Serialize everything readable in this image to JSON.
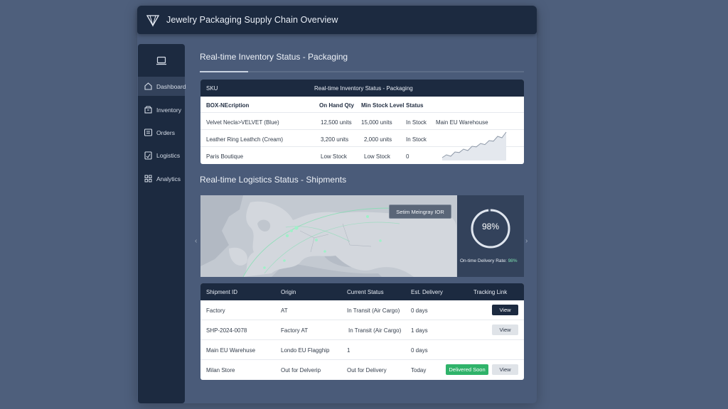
{
  "header": {
    "title": "Jewelry Packaging Supply Chain Overview"
  },
  "sidebar": {
    "items": [
      {
        "label": "Dashboard",
        "icon": "home-icon"
      },
      {
        "label": "Inventory",
        "icon": "box-icon"
      },
      {
        "label": "Orders",
        "icon": "list-icon"
      },
      {
        "label": "Logistics",
        "icon": "clipboard-icon"
      },
      {
        "label": "Analytics",
        "icon": "grid-icon"
      }
    ]
  },
  "inventory": {
    "section_title": "Real-time Inventory Status - Packaging",
    "head_col1": "SKU",
    "head_col2": "Real-time Inventory Status - Packaging",
    "columns": [
      "BOX-NEcription",
      "On Hand Qty",
      "Min Stock Level",
      "Status"
    ],
    "rows": [
      [
        "Velvet Necla>VELVET (Blue)",
        "12,500 units",
        "15,000 units",
        "In Stock",
        "Main EU Warehouse"
      ],
      [
        "Leather Ring Leathch (Cream)",
        "3,200 units",
        "2,000 units",
        "In Stock",
        ""
      ],
      [
        "Paris Boutique",
        "Low Stock",
        "Low Stock",
        "0",
        ""
      ]
    ],
    "sparkline": [
      3,
      4,
      3.5,
      5,
      4.8,
      6,
      5.5,
      7,
      6.8,
      8,
      7.6,
      9,
      8.8,
      10.5,
      10,
      12
    ]
  },
  "logistics": {
    "section_title": "Real-time Logistics Status - Shipments",
    "badge": "Setim Meingray IOR",
    "ontime_value": "98%",
    "ontime_fraction": 0.98,
    "ontime_label": "On-time Delivery Rate:",
    "ontime_rate": "98%",
    "colors": {
      "accent": "#2fb36a",
      "dark": "#1c2a40"
    }
  },
  "shipments": {
    "columns": [
      "Shipment ID",
      "Origin",
      "Current Status",
      "Est. Delivery",
      "Tracking Link"
    ],
    "rows": [
      {
        "id": "Factory",
        "origin": "AT",
        "status": "In Transit (Air Cargo)",
        "eta": "0 days",
        "button": "View",
        "button_style": "dark",
        "badge": ""
      },
      {
        "id": "SHP-2024-0078",
        "origin": "Factory AT",
        "status": "In Transit (Air Cargo)",
        "eta": "1 days",
        "button": "View",
        "button_style": "light",
        "badge": ""
      },
      {
        "id": "Main EU Warehuse",
        "origin": "Londo EU Flagghip",
        "status": "1",
        "eta": "0 days",
        "button": "",
        "button_style": "",
        "badge": ""
      },
      {
        "id": "Milan Store",
        "origin": "Out for Delverip",
        "status": "Out for Delivery",
        "eta": "Today",
        "button": "View",
        "button_style": "light",
        "badge": "Delivered Soon"
      }
    ]
  }
}
